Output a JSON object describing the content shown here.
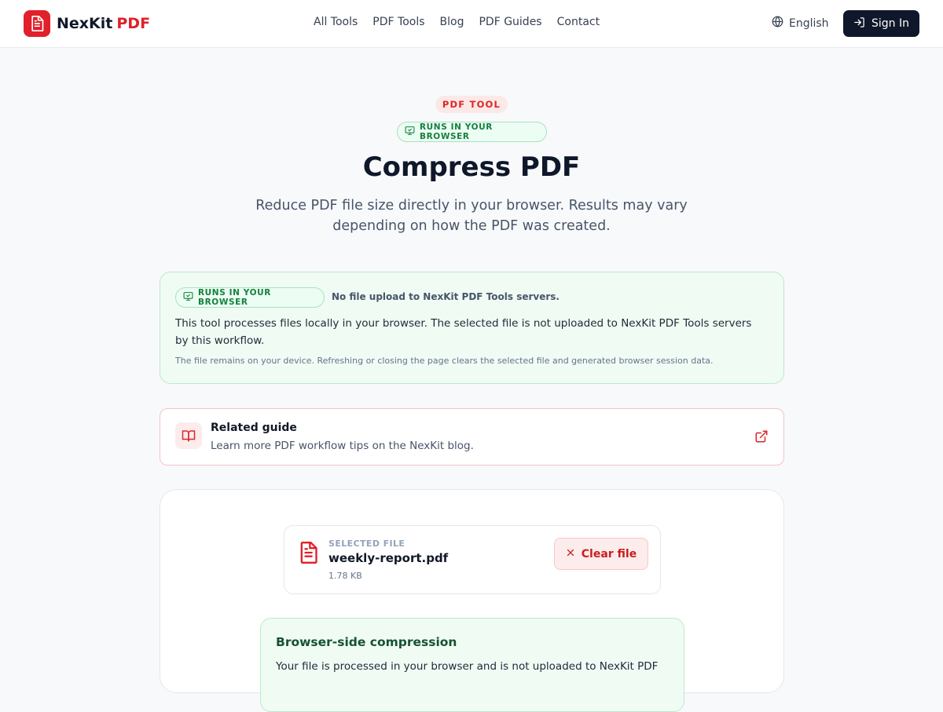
{
  "brand": {
    "name": "NexKit",
    "accent": "PDF",
    "color": "#e0202a"
  },
  "nav": {
    "items": [
      "All Tools",
      "PDF Tools",
      "Blog",
      "PDF Guides",
      "Contact"
    ]
  },
  "header": {
    "language": "English",
    "sign_in": "Sign In"
  },
  "hero": {
    "eyebrow": "PDF TOOL",
    "badge": "RUNS IN YOUR BROWSER",
    "title": "Compress PDF",
    "subtitle": "Reduce PDF file size directly in your browser. Results may vary depending on how the PDF was created."
  },
  "privacy": {
    "badge": "RUNS IN YOUR BROWSER",
    "note": "No file upload to NexKit PDF Tools servers.",
    "text": "This tool processes files locally in your browser. The selected file is not uploaded to NexKit PDF Tools servers by this workflow.",
    "small": "The file remains on your device. Refreshing or closing the page clears the selected file and generated browser session data."
  },
  "guide": {
    "title": "Related guide",
    "description": "Learn more PDF workflow tips on the NexKit blog."
  },
  "file": {
    "label": "SELECTED FILE",
    "name": "weekly-report.pdf",
    "size": "1.78 KB",
    "clear_label": "Clear file"
  },
  "compression": {
    "title": "Browser-side compression",
    "text": "Your file is processed in your browser and is not uploaded to NexKit PDF"
  },
  "icons": {
    "brand": "file-text-icon",
    "language": "globe-icon",
    "sign_in": "log-in-icon",
    "badge": "monitor-check-icon",
    "guide": "book-open-icon",
    "external": "external-link-icon",
    "file": "file-text-icon",
    "clear": "close-icon"
  },
  "colors": {
    "accent": "#e0202a",
    "dark_button": "#0f172a",
    "success_bg": "#f0fbf4",
    "success_text": "#15803d"
  }
}
